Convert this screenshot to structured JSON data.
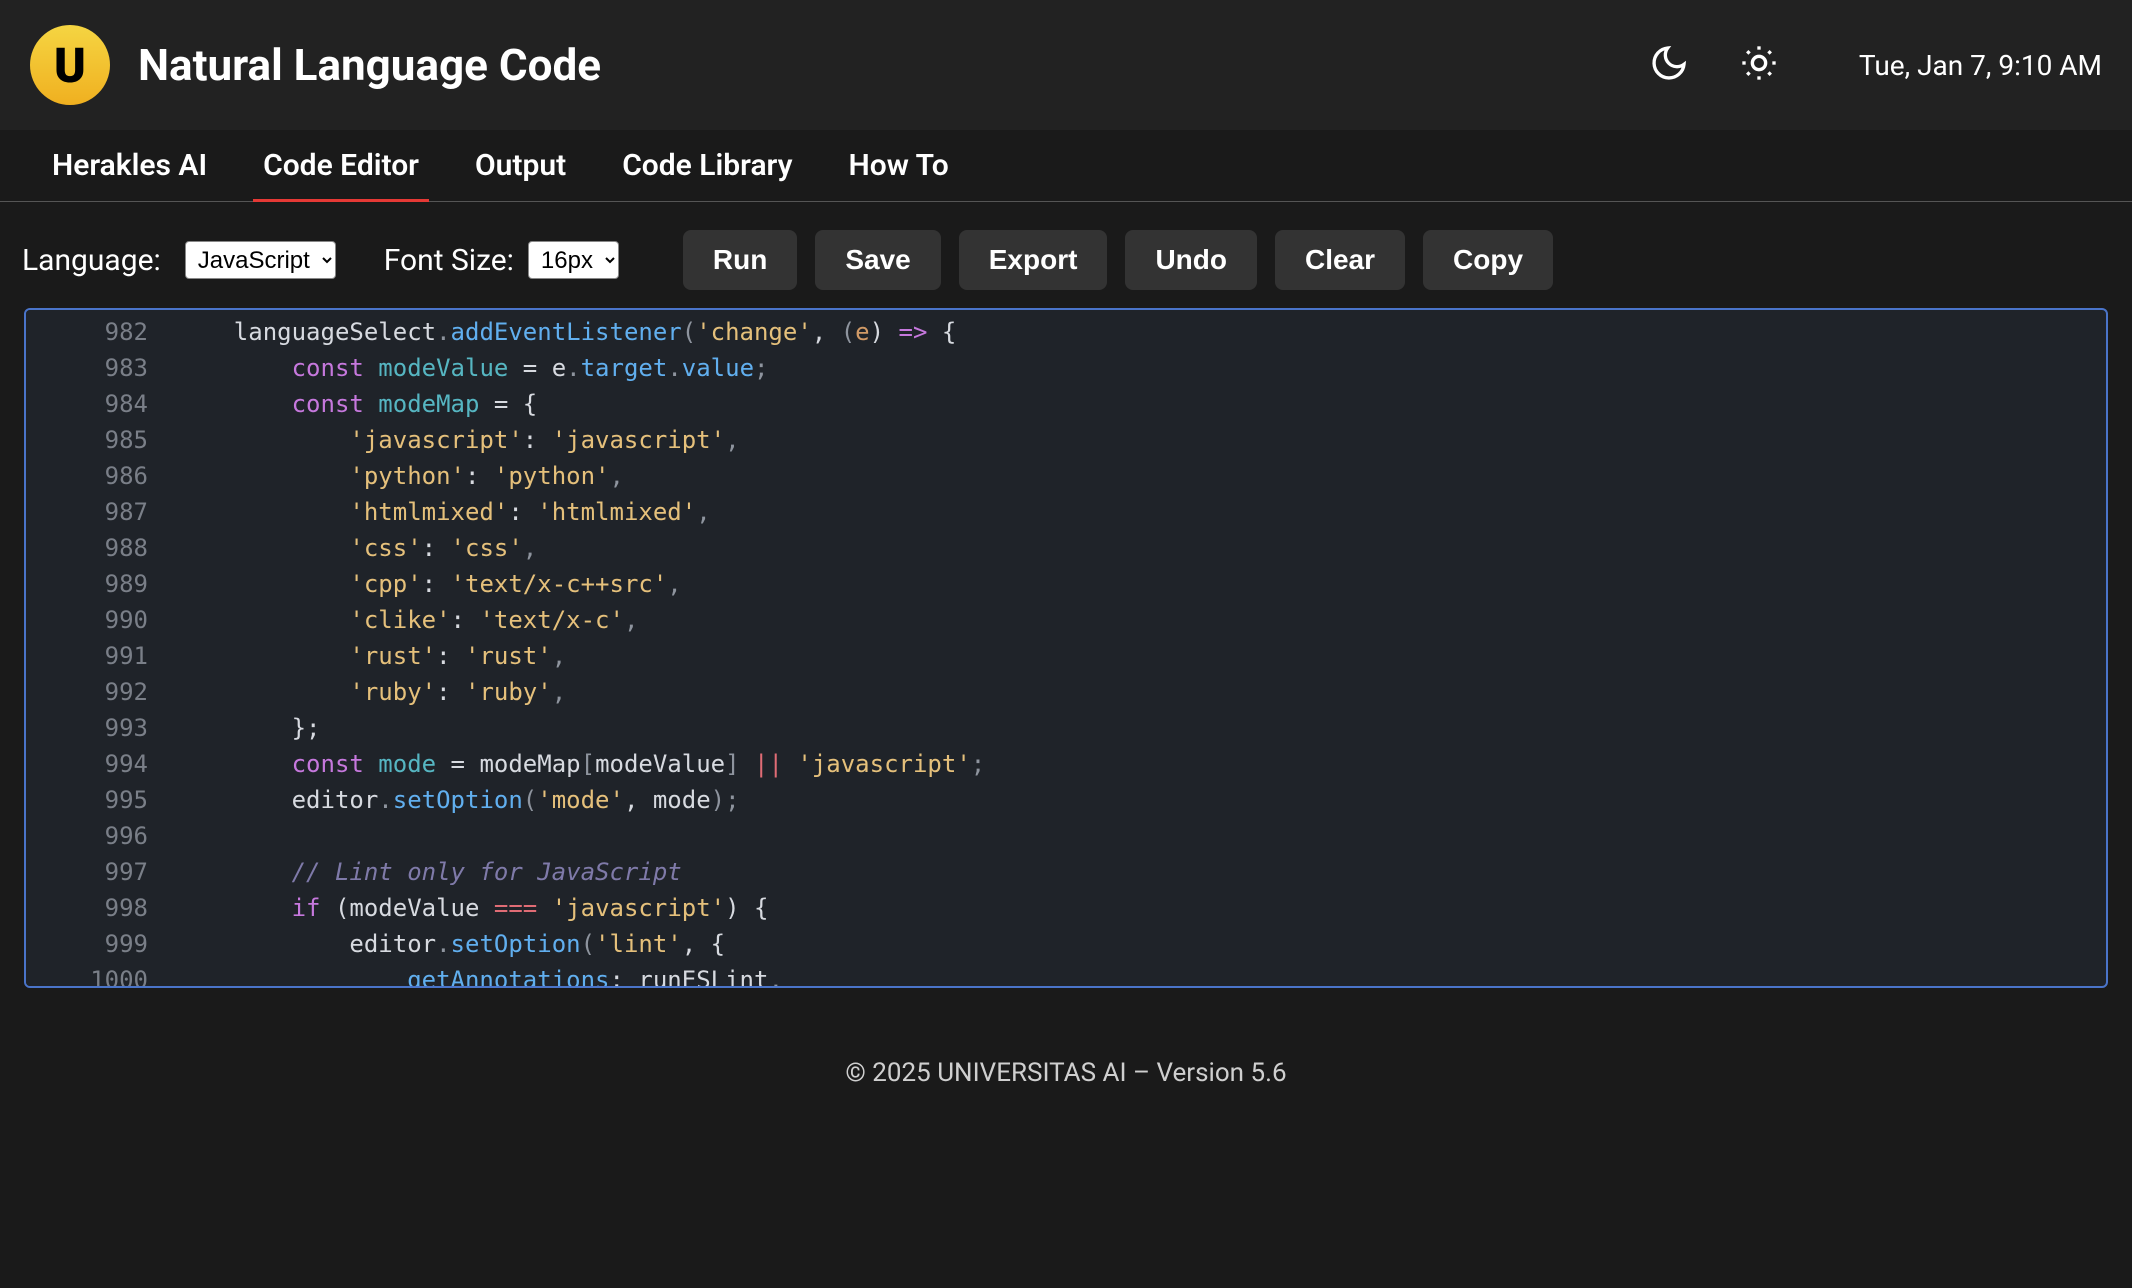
{
  "header": {
    "logo_letter": "U",
    "title": "Natural Language Code",
    "clock": "Tue, Jan 7, 9:10 AM"
  },
  "tabs": [
    {
      "id": "herakles",
      "label": "Herakles AI",
      "active": false
    },
    {
      "id": "editor",
      "label": "Code Editor",
      "active": true
    },
    {
      "id": "output",
      "label": "Output",
      "active": false
    },
    {
      "id": "library",
      "label": "Code Library",
      "active": false
    },
    {
      "id": "howto",
      "label": "How To",
      "active": false
    }
  ],
  "toolbar": {
    "language_label": "Language:",
    "language_value": "JavaScript",
    "fontsize_label": "Font Size:",
    "fontsize_value": "16px",
    "buttons": {
      "run": "Run",
      "save": "Save",
      "export": "Export",
      "undo": "Undo",
      "clear": "Clear",
      "copy": "Copy"
    }
  },
  "editor": {
    "first_line_number": 982,
    "lines": [
      [
        [
          "    ",
          "punct-w"
        ],
        [
          "languageSelect",
          "id"
        ],
        [
          ".",
          "punct"
        ],
        [
          "addEventListener",
          "prop"
        ],
        [
          "(",
          "punct"
        ],
        [
          "'change'",
          "str"
        ],
        [
          ", ",
          "punct-w"
        ],
        [
          "(",
          "punct"
        ],
        [
          "e",
          "param"
        ],
        [
          ") ",
          "punct-w"
        ],
        [
          "=>",
          "arrow"
        ],
        [
          " {",
          "punct-w"
        ]
      ],
      [
        [
          "        ",
          "punct-w"
        ],
        [
          "const",
          "kw"
        ],
        [
          " ",
          "punct-w"
        ],
        [
          "modeValue",
          "var"
        ],
        [
          " ",
          "punct-w"
        ],
        [
          "=",
          "op"
        ],
        [
          " ",
          "punct-w"
        ],
        [
          "e",
          "id"
        ],
        [
          ".",
          "punct"
        ],
        [
          "target",
          "prop"
        ],
        [
          ".",
          "punct"
        ],
        [
          "value",
          "prop"
        ],
        [
          ";",
          "punct"
        ]
      ],
      [
        [
          "        ",
          "punct-w"
        ],
        [
          "const",
          "kw"
        ],
        [
          " ",
          "punct-w"
        ],
        [
          "modeMap",
          "var"
        ],
        [
          " ",
          "punct-w"
        ],
        [
          "=",
          "op"
        ],
        [
          " {",
          "punct-w"
        ]
      ],
      [
        [
          "            ",
          "punct-w"
        ],
        [
          "'javascript'",
          "str"
        ],
        [
          ":",
          "punct-w"
        ],
        [
          " ",
          "punct-w"
        ],
        [
          "'javascript'",
          "str"
        ],
        [
          ",",
          "punct"
        ]
      ],
      [
        [
          "            ",
          "punct-w"
        ],
        [
          "'python'",
          "str"
        ],
        [
          ":",
          "punct-w"
        ],
        [
          " ",
          "punct-w"
        ],
        [
          "'python'",
          "str"
        ],
        [
          ",",
          "punct"
        ]
      ],
      [
        [
          "            ",
          "punct-w"
        ],
        [
          "'htmlmixed'",
          "str"
        ],
        [
          ":",
          "punct-w"
        ],
        [
          " ",
          "punct-w"
        ],
        [
          "'htmlmixed'",
          "str"
        ],
        [
          ",",
          "punct"
        ]
      ],
      [
        [
          "            ",
          "punct-w"
        ],
        [
          "'css'",
          "str"
        ],
        [
          ":",
          "punct-w"
        ],
        [
          " ",
          "punct-w"
        ],
        [
          "'css'",
          "str"
        ],
        [
          ",",
          "punct"
        ]
      ],
      [
        [
          "            ",
          "punct-w"
        ],
        [
          "'cpp'",
          "str"
        ],
        [
          ":",
          "punct-w"
        ],
        [
          " ",
          "punct-w"
        ],
        [
          "'text/x-c++src'",
          "str"
        ],
        [
          ",",
          "punct"
        ]
      ],
      [
        [
          "            ",
          "punct-w"
        ],
        [
          "'clike'",
          "str"
        ],
        [
          ":",
          "punct-w"
        ],
        [
          " ",
          "punct-w"
        ],
        [
          "'text/x-c'",
          "str"
        ],
        [
          ",",
          "punct"
        ]
      ],
      [
        [
          "            ",
          "punct-w"
        ],
        [
          "'rust'",
          "str"
        ],
        [
          ":",
          "punct-w"
        ],
        [
          " ",
          "punct-w"
        ],
        [
          "'rust'",
          "str"
        ],
        [
          ",",
          "punct"
        ]
      ],
      [
        [
          "            ",
          "punct-w"
        ],
        [
          "'ruby'",
          "str"
        ],
        [
          ":",
          "punct-w"
        ],
        [
          " ",
          "punct-w"
        ],
        [
          "'ruby'",
          "str"
        ],
        [
          ",",
          "punct"
        ]
      ],
      [
        [
          "        };",
          "punct-w"
        ]
      ],
      [
        [
          "        ",
          "punct-w"
        ],
        [
          "const",
          "kw"
        ],
        [
          " ",
          "punct-w"
        ],
        [
          "mode",
          "var"
        ],
        [
          " ",
          "punct-w"
        ],
        [
          "=",
          "op"
        ],
        [
          " ",
          "punct-w"
        ],
        [
          "modeMap",
          "id"
        ],
        [
          "[",
          "punct"
        ],
        [
          "modeValue",
          "id"
        ],
        [
          "]",
          "punct"
        ],
        [
          " ",
          "punct-w"
        ],
        [
          "||",
          "op-red"
        ],
        [
          " ",
          "punct-w"
        ],
        [
          "'javascript'",
          "str"
        ],
        [
          ";",
          "punct"
        ]
      ],
      [
        [
          "        ",
          "punct-w"
        ],
        [
          "editor",
          "id"
        ],
        [
          ".",
          "punct"
        ],
        [
          "setOption",
          "prop"
        ],
        [
          "(",
          "punct"
        ],
        [
          "'mode'",
          "str"
        ],
        [
          ", ",
          "punct-w"
        ],
        [
          "mode",
          "id"
        ],
        [
          ")",
          "punct"
        ],
        [
          ";",
          "punct"
        ]
      ],
      [
        [
          "",
          "punct-w"
        ]
      ],
      [
        [
          "        ",
          "punct-w"
        ],
        [
          "// Lint only for JavaScript",
          "comment"
        ]
      ],
      [
        [
          "        ",
          "punct-w"
        ],
        [
          "if",
          "kw"
        ],
        [
          " (",
          "punct-w"
        ],
        [
          "modeValue",
          "id"
        ],
        [
          " ",
          "punct-w"
        ],
        [
          "===",
          "op-red"
        ],
        [
          " ",
          "punct-w"
        ],
        [
          "'javascript'",
          "str"
        ],
        [
          ") {",
          "punct-w"
        ]
      ],
      [
        [
          "            ",
          "punct-w"
        ],
        [
          "editor",
          "id"
        ],
        [
          ".",
          "punct"
        ],
        [
          "setOption",
          "prop"
        ],
        [
          "(",
          "punct"
        ],
        [
          "'lint'",
          "str"
        ],
        [
          ", {",
          "punct-w"
        ]
      ],
      [
        [
          "                ",
          "punct-w"
        ],
        [
          "getAnnotations",
          "prop"
        ],
        [
          ":",
          "punct-w"
        ],
        [
          " ",
          "punct-w"
        ],
        [
          "runESLint",
          "id"
        ],
        [
          ",",
          "punct"
        ]
      ]
    ]
  },
  "footer": {
    "text": "© 2025 UNIVERSITAS AI – Version 5.6"
  }
}
